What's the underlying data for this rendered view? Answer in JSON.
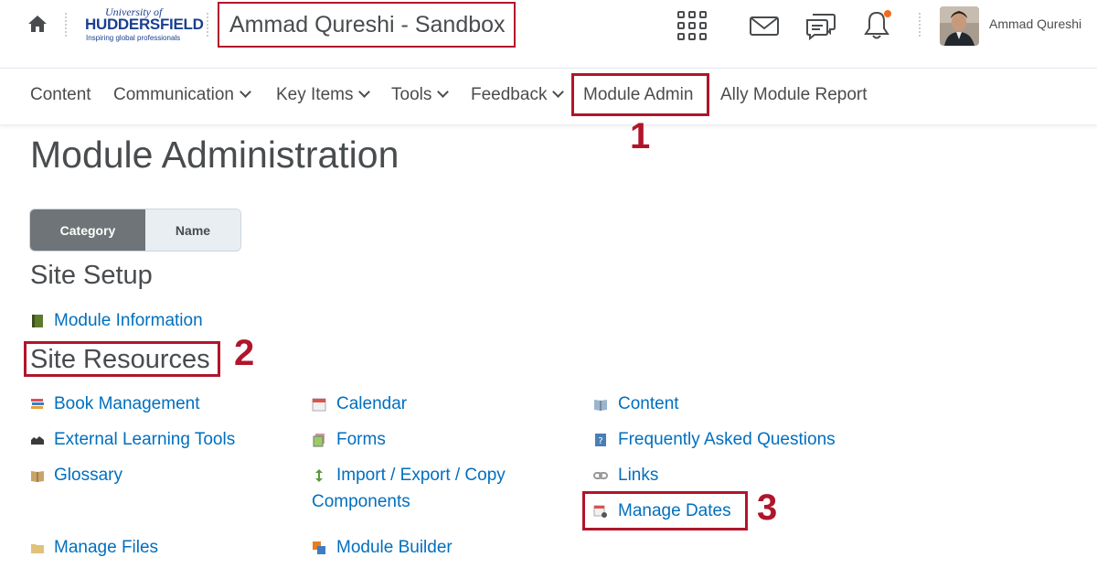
{
  "header": {
    "logo": {
      "line1": "University of",
      "line2": "HUDDERSFIELD",
      "line3": "Inspiring global professionals"
    },
    "course_title": "Ammad Qureshi - Sandbox",
    "user_name": "Ammad Qureshi",
    "icons": [
      "home-icon",
      "waffle-grid-icon",
      "mail-icon",
      "chat-icon",
      "bell-icon"
    ]
  },
  "nav": {
    "items": [
      {
        "label": "Content"
      },
      {
        "label": "Communication"
      },
      {
        "label": "Key Items"
      },
      {
        "label": "Tools"
      },
      {
        "label": "Feedback"
      },
      {
        "label": "Module Admin"
      },
      {
        "label": "Ally Module Report"
      }
    ]
  },
  "annotations": {
    "marker1": "1",
    "marker2": "2",
    "marker3": "3",
    "highlight_color": "#b0152b"
  },
  "main": {
    "title": "Module Administration",
    "view_toggle": {
      "category": "Category",
      "name": "Name",
      "selected": "Category"
    },
    "site_setup": {
      "heading": "Site Setup",
      "links": [
        {
          "label": "Module Information",
          "icon": "book-icon"
        }
      ]
    },
    "site_resources": {
      "heading": "Site Resources",
      "links": [
        {
          "label": "Book Management",
          "icon": "books-stack-icon"
        },
        {
          "label": "External Learning Tools",
          "icon": "puzzle-icon"
        },
        {
          "label": "Glossary",
          "icon": "open-book-icon"
        },
        {
          "label": "Manage Files",
          "icon": "folder-icon"
        },
        {
          "label": "Calendar",
          "icon": "calendar-icon"
        },
        {
          "label": "Forms",
          "icon": "forms-icon"
        },
        {
          "label_line1": "Import / Export / Copy",
          "label_line2": "Components",
          "icon": "import-export-icon"
        },
        {
          "label": "Module Builder",
          "icon": "module-builder-icon"
        },
        {
          "label": "Content",
          "icon": "open-book-icon"
        },
        {
          "label": "Frequently Asked Questions",
          "icon": "faq-icon"
        },
        {
          "label": "Links",
          "icon": "chain-link-icon"
        },
        {
          "label": "Manage Dates",
          "icon": "calendar-gear-icon"
        }
      ]
    }
  },
  "colors": {
    "link": "#006fbf",
    "text": "#494c4e",
    "toggle_selected_bg": "#6e7477",
    "notification_dot": "#f26b1d"
  }
}
